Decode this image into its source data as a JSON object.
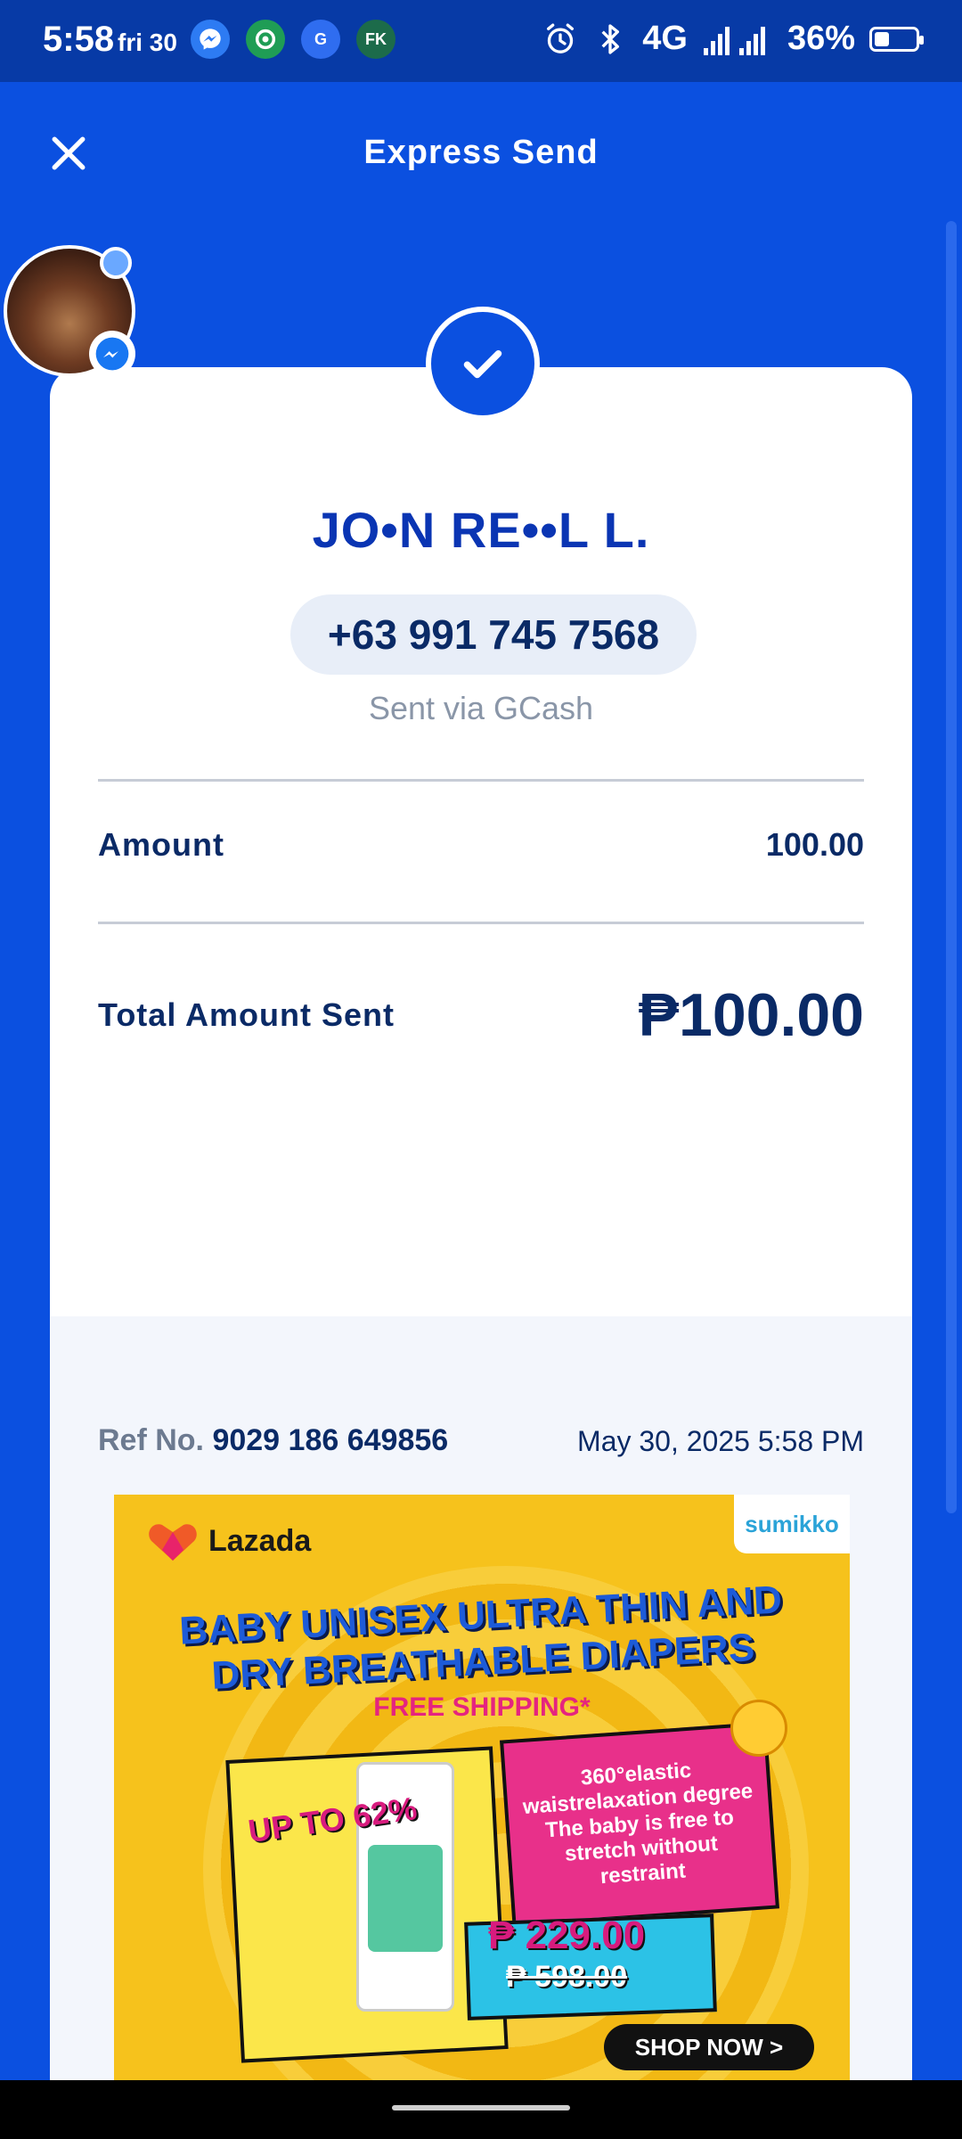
{
  "status_bar": {
    "time": "5:58",
    "day": "fri 30",
    "network": "4G",
    "battery": "36%",
    "battery_level": 0.36,
    "apps": [
      "messenger-icon",
      "grab-icon",
      "gcash-icon",
      "fk-icon"
    ]
  },
  "header": {
    "title": "Express Send",
    "close_icon": "close-icon"
  },
  "receipt": {
    "recipient_name": "JO•N RE••L L.",
    "phone": "+63 991 745 7568",
    "sent_via": "Sent via GCash",
    "amount_label": "Amount",
    "amount_value": "100.00",
    "total_label": "Total Amount Sent",
    "total_value": "₱100.00",
    "ref_label": "Ref No.",
    "ref_number": "9029 186 649856",
    "datetime": "May 30, 2025 5:58 PM"
  },
  "ad": {
    "brand": "Lazada",
    "partner": "sumikko",
    "headline": "BABY UNISEX ULTRA THIN AND DRY BREATHABLE DIAPERS",
    "shipping": "FREE SHIPPING*",
    "discount": "UP TO 62%",
    "feature": "360°elastic waistrelaxation degree The baby is free to stretch without restraint",
    "price": "₱ 229.00",
    "old_price": "₱ 598.00",
    "cta": "SHOP NOW >"
  },
  "colors": {
    "primary": "#0b50e0",
    "status_bar": "#073aa6",
    "text_dark": "#0a2a66",
    "name_blue": "#0a35b3"
  }
}
